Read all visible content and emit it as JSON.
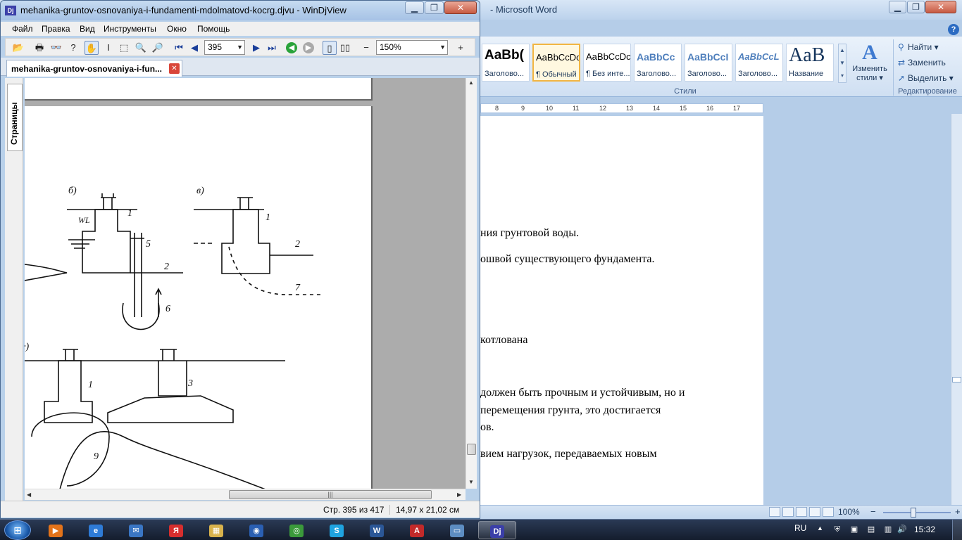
{
  "word": {
    "title": "- Microsoft Word",
    "window_controls": {
      "minimize": "▁",
      "maximize": "❐",
      "close": "✕"
    },
    "help": "?",
    "styles": [
      {
        "sample": "AaBb(",
        "name": "Заголово..."
      },
      {
        "sample": "AaBbCcDc",
        "name": "¶ Обычный",
        "selected": true
      },
      {
        "sample": "AaBbCcDc",
        "name": "¶ Без инте..."
      },
      {
        "sample": "AaBbCc",
        "name": "Заголово..."
      },
      {
        "sample": "AaBbCcI",
        "name": "Заголово..."
      },
      {
        "sample": "AaBbCcL",
        "name": "Заголово..."
      },
      {
        "sample": "AaB",
        "name": "Название"
      }
    ],
    "styles_scroll": [
      "▲",
      "▼",
      "▾"
    ],
    "change_styles": {
      "icon": "A",
      "label1": "Изменить",
      "label2": "стили ▾"
    },
    "styles_group_label": "Стили",
    "editing": {
      "find": "Найти ▾",
      "replace": "Заменить",
      "select": "Выделить ▾",
      "label": "Редактирование"
    },
    "ruler_marks": [
      "8",
      "9",
      "10",
      "11",
      "12",
      "13",
      "14",
      "15",
      "16",
      "17"
    ],
    "doc_lines": [
      "ния грунтовой воды.",
      "ошвой существующего фундамента.",
      "котлована",
      "должен быть прочным  и устойчивым, но и",
      "перемещения грунта,  это достигается",
      "ов.",
      "вием нагрузок, передаваемых новым"
    ],
    "zoom": "100%",
    "zoom_minus": "−",
    "zoom_plus": "+"
  },
  "djview": {
    "title": "mehanika-gruntov-osnovaniya-i-fundamenti-mdolmatovd-kocrg.djvu - WinDjView",
    "app_icon": "Dj",
    "window_controls": {
      "minimize": "▁",
      "maximize": "❐",
      "close": "✕"
    },
    "menu": [
      "Файл",
      "Правка",
      "Вид",
      "Инструменты",
      "Окно",
      "Помощь"
    ],
    "toolbar": {
      "open": "📂",
      "print": "🖶",
      "find": "👓",
      "help": "?",
      "hand": "✋",
      "select_text": "I",
      "select_rect": "⬚",
      "zoom": "🔍",
      "magnify": "🔎",
      "first": "⏮",
      "prev": "◀",
      "page": "395",
      "next": "▶",
      "last": "⏭",
      "back": "◀",
      "forward": "▶",
      "fit_page": "▯",
      "two_pages": "▯▯",
      "zoom_out": "−",
      "zoom_value": "150%",
      "zoom_in": "+"
    },
    "tab_label": "mehanika-gruntov-osnovaniya-i-fun...",
    "tab_close": "✕",
    "side_label": "Страницы",
    "drawing_labels": [
      "б)",
      "в)",
      "1",
      "1",
      "WL",
      "5",
      "2",
      "2",
      "6",
      "7",
      "1",
      "3",
      "9",
      "г)"
    ],
    "status_page": "Стр. 395 из 417",
    "status_size": "14,97 x 21,02 см",
    "scroll_grip": "|||"
  },
  "taskbar": {
    "start": "⊞",
    "items": [
      {
        "glyph": "▶",
        "color": "#e3731a"
      },
      {
        "glyph": "e",
        "color": "#2e7bd6"
      },
      {
        "glyph": "✉",
        "color": "#3a76c4"
      },
      {
        "glyph": "Я",
        "color": "#d62e2e"
      },
      {
        "glyph": "▦",
        "color": "#d8b24c"
      },
      {
        "glyph": "◉",
        "color": "#2a5fb2"
      },
      {
        "glyph": "◎",
        "color": "#3b9a3b"
      },
      {
        "glyph": "S",
        "color": "#1fa3e0"
      },
      {
        "glyph": "W",
        "color": "#2b5797"
      },
      {
        "glyph": "A",
        "color": "#c22a2a"
      },
      {
        "glyph": "▭",
        "color": "#5d8dc2"
      },
      {
        "glyph": "Dj",
        "color": "#3b3fa8"
      }
    ],
    "lang": "RU",
    "tray_arrow": "▲",
    "tray_icons": [
      "⛨",
      "▣",
      "▤",
      "▥",
      "🔊"
    ],
    "clock": "15:32"
  }
}
